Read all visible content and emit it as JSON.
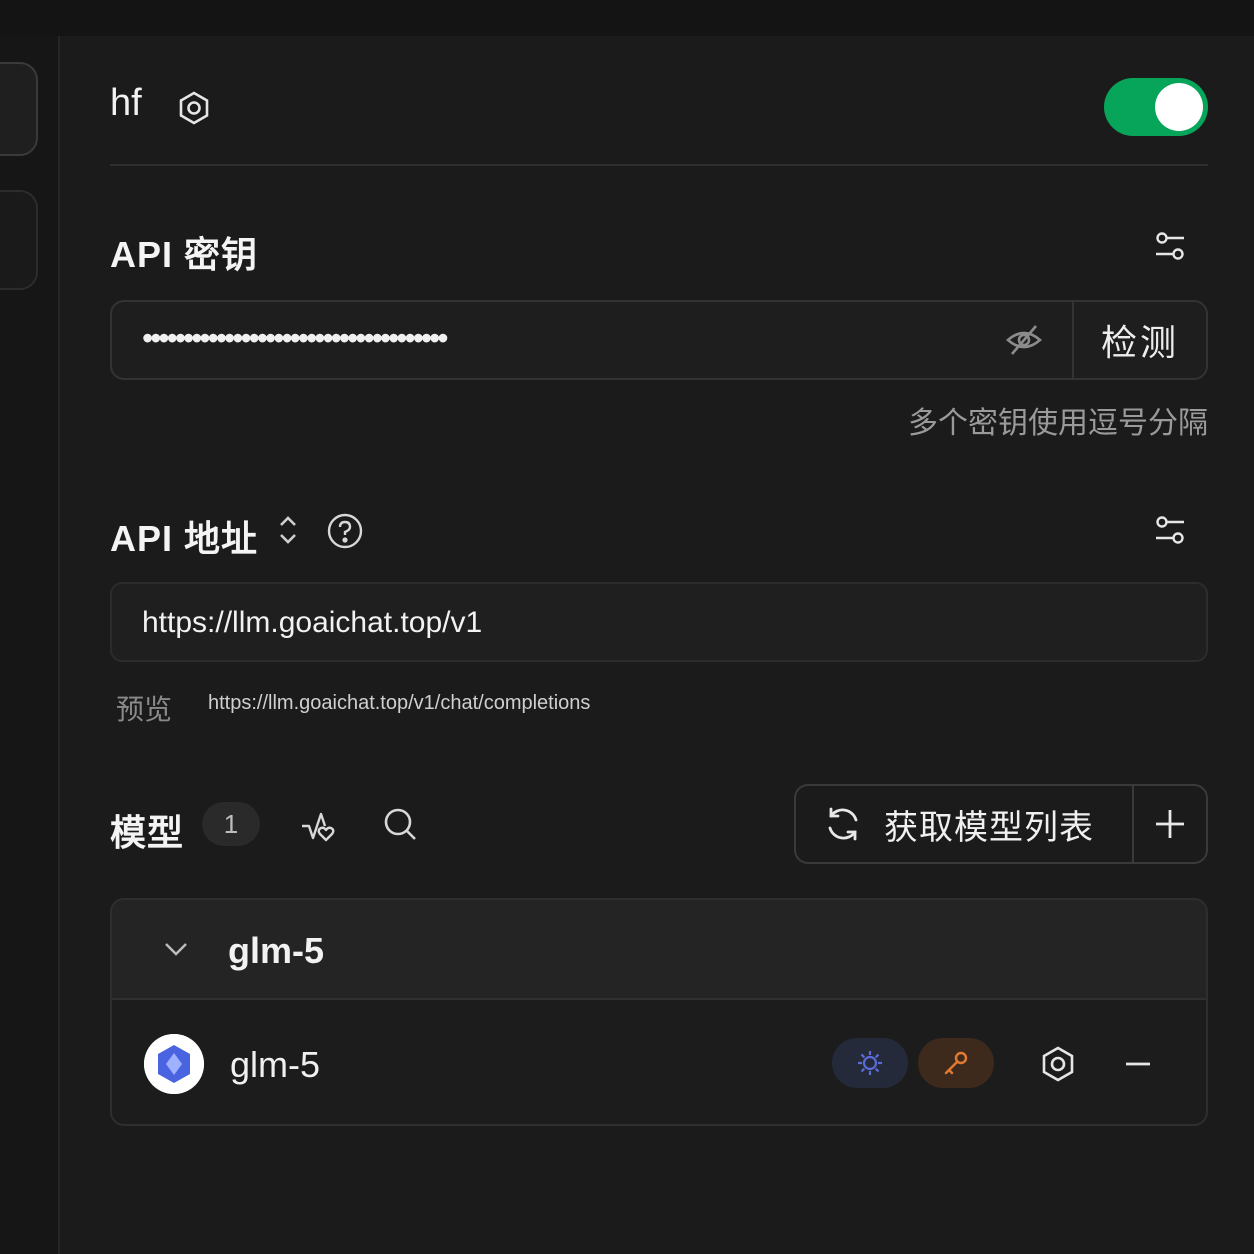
{
  "provider": {
    "name": "hf",
    "enabled": true,
    "colors": {
      "toggle_on": "#07a55a",
      "tag_vision": "#5b6bd8",
      "tag_tool": "#e27a32"
    }
  },
  "api_key": {
    "title": "API 密钥",
    "value": "•••••••••••••••••••••••••••••••••••••",
    "check_label": "检测",
    "hint": "多个密钥使用逗号分隔"
  },
  "api_url": {
    "title": "API 地址",
    "value": "https://llm.goaichat.top/v1",
    "preview_label": "预览",
    "preview_url": "https://llm.goaichat.top/v1/chat/completions"
  },
  "models": {
    "title": "模型",
    "count": "1",
    "fetch_label": "获取模型列表",
    "groups": [
      {
        "name": "glm-5",
        "items": [
          {
            "name": "glm-5",
            "tags": [
              "vision-icon",
              "tool-icon"
            ]
          }
        ]
      }
    ]
  }
}
